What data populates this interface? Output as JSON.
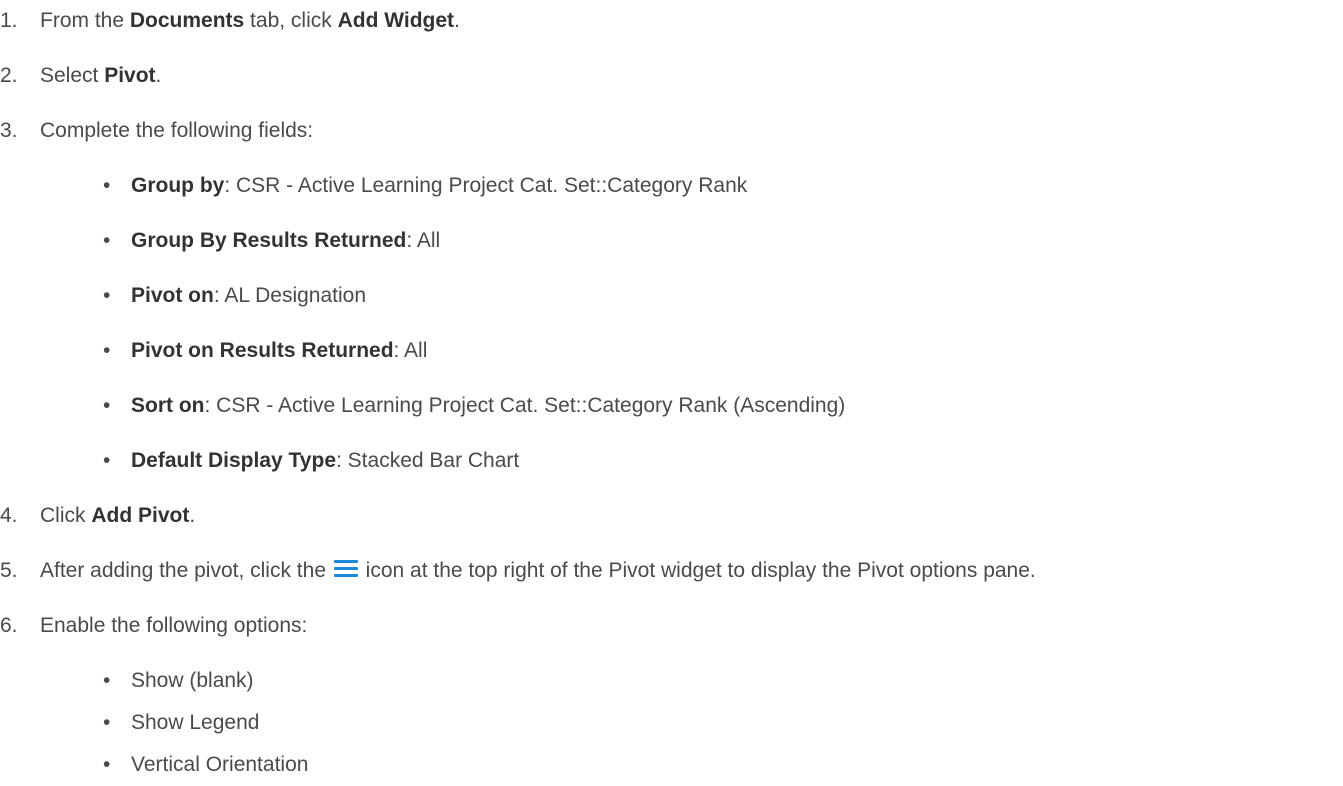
{
  "steps": [
    {
      "num": "1.",
      "pre": "From the ",
      "b1": "Documents",
      "mid": " tab, click ",
      "b2": "Add Widget",
      "post": "."
    },
    {
      "num": "2.",
      "pre": "Select ",
      "b1": "Pivot",
      "post": "."
    },
    {
      "num": "3.",
      "text": "Complete the following fields:"
    },
    {
      "num": "4.",
      "pre": "Click ",
      "b1": "Add Pivot",
      "post": "."
    },
    {
      "num": "5.",
      "pre": "After adding the pivot, click the ",
      "post": " icon at the top right of the Pivot widget to display the Pivot options pane.",
      "icon": "hamburger-menu-icon"
    },
    {
      "num": "6.",
      "text": "Enable the following options:"
    }
  ],
  "fields": [
    {
      "label": "Group by",
      "value": ": CSR - Active Learning Project Cat. Set::Category Rank"
    },
    {
      "label": "Group By Results Returned",
      "value": ": All"
    },
    {
      "label": "Pivot on",
      "value": ": AL Designation"
    },
    {
      "label": "Pivot on Results Returned",
      "value": ": All"
    },
    {
      "label": "Sort on",
      "value": ": CSR - Active Learning Project Cat. Set::Category Rank (Ascending)"
    },
    {
      "label": "Default Display Type",
      "value": ": Stacked Bar Chart"
    }
  ],
  "options": [
    "Show (blank)",
    "Show Legend",
    "Vertical Orientation"
  ],
  "bullet": "•",
  "colors": {
    "text": "#4a4a4a",
    "icon": "#1e88d8"
  }
}
